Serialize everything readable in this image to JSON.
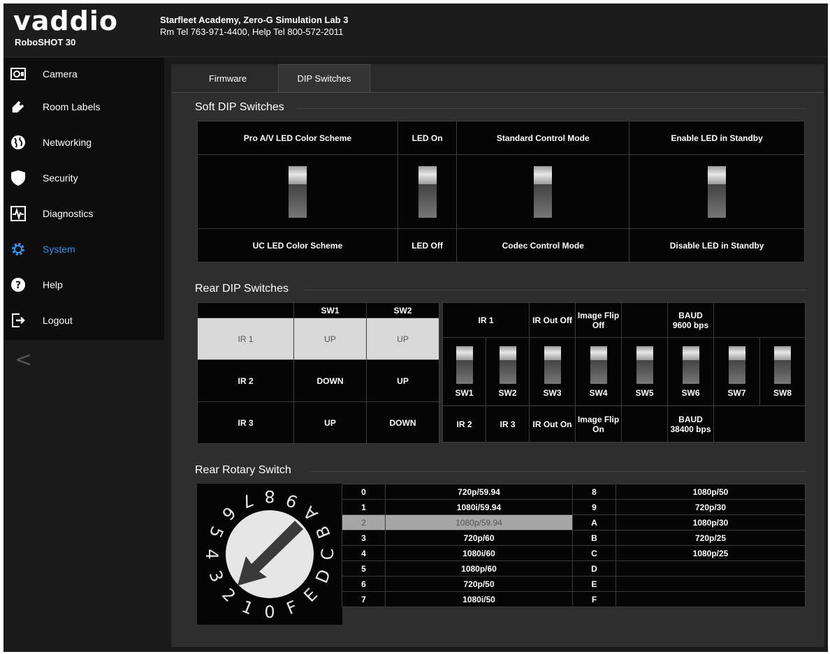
{
  "header": {
    "brand": "vaddio",
    "model": "RoboSHOT 30",
    "location": "Starfleet Academy, Zero-G Simulation Lab 3",
    "phones": "Rm Tel 763-971-4400, Help Tel 800-572-2011"
  },
  "sidebar": {
    "items": [
      {
        "label": "Camera",
        "icon": "camera-icon"
      },
      {
        "label": "Room Labels",
        "icon": "tag-icon"
      },
      {
        "label": "Networking",
        "icon": "globe-icon"
      },
      {
        "label": "Security",
        "icon": "shield-icon"
      },
      {
        "label": "Diagnostics",
        "icon": "pulse-icon"
      },
      {
        "label": "System",
        "icon": "gear-icon"
      },
      {
        "label": "Help",
        "icon": "question-icon"
      },
      {
        "label": "Logout",
        "icon": "logout-icon"
      }
    ],
    "active": "System",
    "collapse_glyph": "<"
  },
  "tabs": [
    {
      "label": "Firmware",
      "selected": false
    },
    {
      "label": "DIP Switches",
      "selected": true
    }
  ],
  "soft_dip": {
    "title": "Soft DIP Switches",
    "switches": [
      {
        "up": "Pro A/V LED Color Scheme",
        "down": "UC LED Color Scheme"
      },
      {
        "up": "LED On",
        "down": "LED Off"
      },
      {
        "up": "Standard Control Mode",
        "down": "Codec Control Mode"
      },
      {
        "up": "Enable LED in Standby",
        "down": "Disable LED in Standby"
      }
    ]
  },
  "rear_dip": {
    "title": "Rear DIP Switches",
    "headers": [
      "",
      "SW1",
      "SW2"
    ],
    "rows": [
      [
        "IR 1",
        "UP",
        "UP"
      ],
      [
        "IR 2",
        "DOWN",
        "UP"
      ],
      [
        "IR 3",
        "UP",
        "DOWN"
      ]
    ],
    "top_labels": [
      "IR 1",
      "IR Out Off",
      "Image Flip",
      "Off",
      "BAUD",
      "9600 bps"
    ],
    "switch_names": [
      "SW1",
      "SW2",
      "SW3",
      "SW4",
      "SW5",
      "SW6",
      "SW7",
      "SW8"
    ],
    "bottom_labels": [
      "IR 2",
      "IR 3",
      "IR Out On",
      "Image Flip",
      "On",
      "BAUD",
      "38400 bps"
    ]
  },
  "rotary": {
    "title": "Rear Rotary Switch",
    "dial_digits": [
      "0",
      "1",
      "2",
      "3",
      "4",
      "5",
      "6",
      "7",
      "8",
      "9",
      "A",
      "B",
      "C",
      "D",
      "E",
      "F"
    ],
    "rows_left": [
      [
        "0",
        "720p/59.94"
      ],
      [
        "1",
        "1080i/59.94"
      ],
      [
        "2",
        "1080p/59.94"
      ],
      [
        "3",
        "720p/60"
      ],
      [
        "4",
        "1080i/60"
      ],
      [
        "5",
        "1080p/60"
      ],
      [
        "6",
        "720p/50"
      ],
      [
        "7",
        "1080i/50"
      ]
    ],
    "rows_right": [
      [
        "8",
        "1080p/50"
      ],
      [
        "9",
        "720p/30"
      ],
      [
        "A",
        "1080p/30"
      ],
      [
        "B",
        "720p/25"
      ],
      [
        "C",
        "1080p/25"
      ],
      [
        "D",
        ""
      ],
      [
        "E",
        ""
      ],
      [
        "F",
        ""
      ]
    ],
    "selected": "2"
  },
  "colors": {
    "accent": "#3a8ee6",
    "highlight_row": "#d8d8d8",
    "selected_rotary": "#a6a6a6"
  }
}
